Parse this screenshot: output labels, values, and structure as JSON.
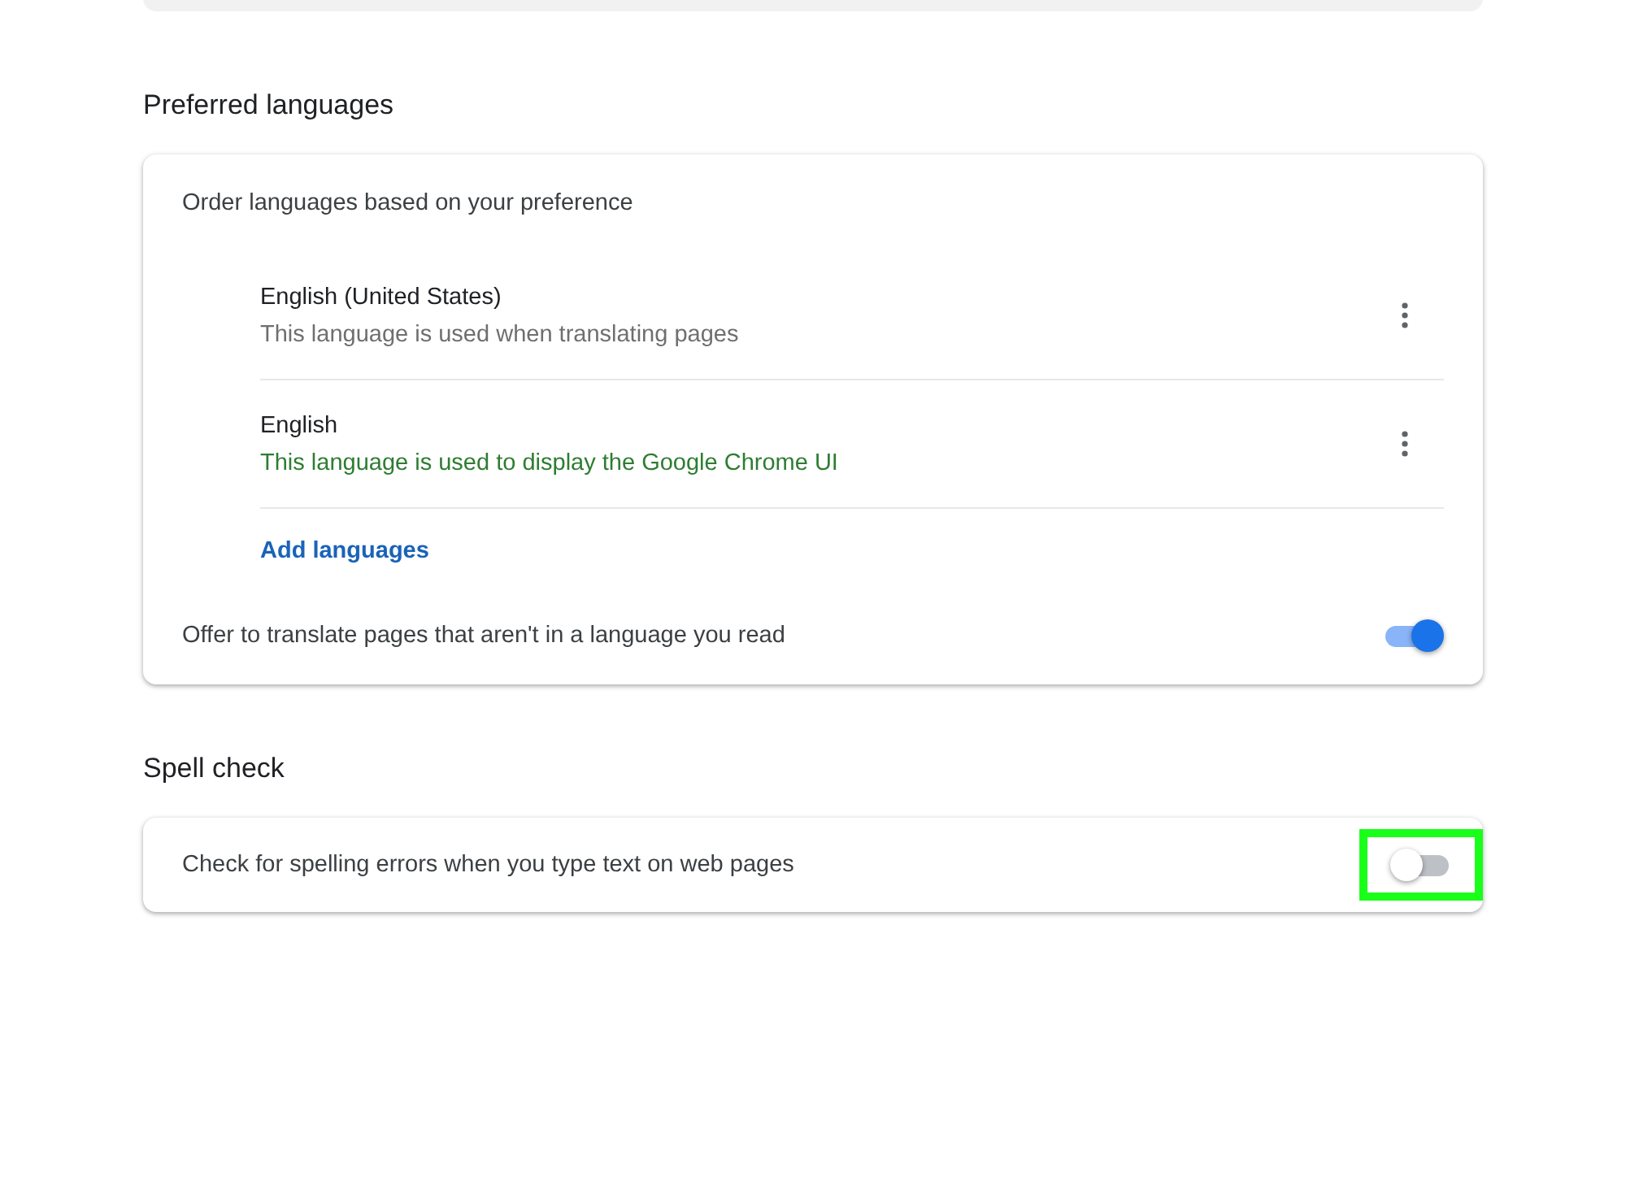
{
  "preferred_languages": {
    "heading": "Preferred languages",
    "order_label": "Order languages based on your preference",
    "languages": [
      {
        "name": "English (United States)",
        "note": "This language is used when translating pages",
        "ui_language": false
      },
      {
        "name": "English",
        "note": "This language is used to display the Google Chrome UI",
        "ui_language": true
      }
    ],
    "add_link": "Add languages",
    "translate_offer": {
      "label": "Offer to translate pages that aren't in a language you read",
      "on": true
    }
  },
  "spell_check": {
    "heading": "Spell check",
    "setting": {
      "label": "Check for spelling errors when you type text on web pages",
      "on": false,
      "highlighted": true
    }
  }
}
